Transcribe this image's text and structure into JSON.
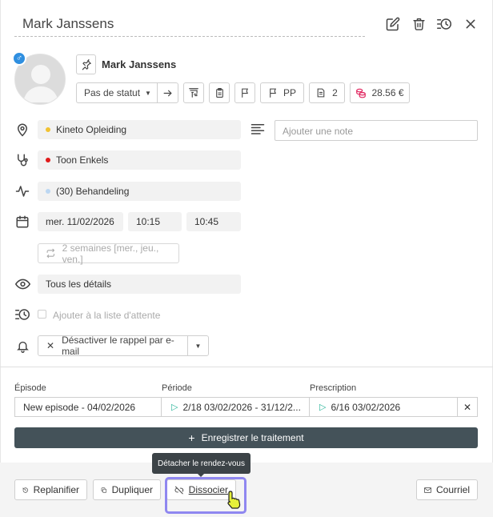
{
  "header": {
    "title": "Mark Janssens",
    "icons": [
      "edit-icon",
      "trash-icon",
      "history-icon",
      "close-icon"
    ]
  },
  "patient": {
    "name": "Mark Janssens",
    "gender_symbol": "♂",
    "status": "Pas de statut",
    "pp_label": "PP",
    "doc_count": "2",
    "balance": "28.56 €"
  },
  "details": {
    "location": "Kineto Opleiding",
    "location_color": "#f1c232",
    "therapist": "Toon Enkels",
    "therapist_color": "#e01b1b",
    "treatment": "(30) Behandeling",
    "treatment_color": "#bcd7f2",
    "date": "mer. 11/02/2026",
    "start_time": "10:15",
    "end_time": "10:45",
    "recurrence": "2 semaines [mer., jeu., ven.]",
    "visibility": "Tous les détails",
    "waitlist_label": "Ajouter à la liste d'attente",
    "reminder": "Désactiver le rappel par e-mail",
    "note_placeholder": "Ajouter une note"
  },
  "treatment_section": {
    "episode_label": "Épisode",
    "episode_value": "New episode - 04/02/2026",
    "period_label": "Période",
    "period_value": "2/18 03/02/2026 - 31/12/2...",
    "prescription_label": "Prescription",
    "prescription_value": "6/16 03/02/2026",
    "register_label": "Enregistrer le traitement"
  },
  "footer": {
    "tooltip": "Détacher le rendez-vous",
    "reschedule": "Replanifier",
    "duplicate": "Dupliquer",
    "dissociate": "Dissocier",
    "email": "Courriel"
  },
  "colors": {
    "accent_dark": "#445259",
    "highlight": "#8f87f0",
    "balance_icon": "#e0245e"
  }
}
